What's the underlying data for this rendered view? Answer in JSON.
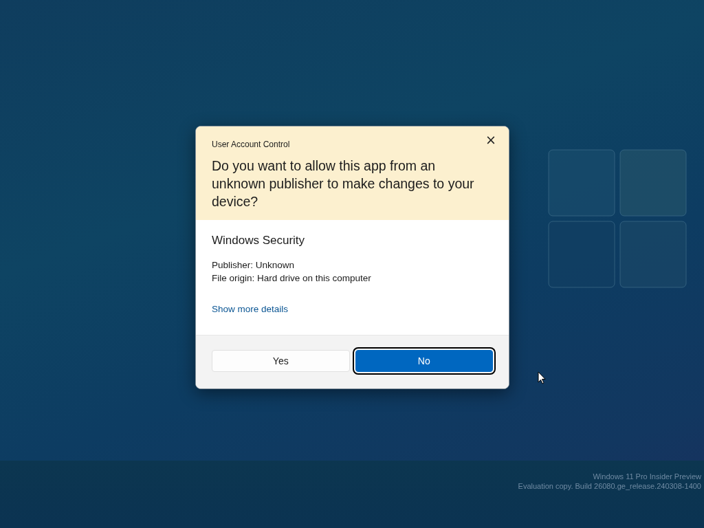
{
  "dialog": {
    "title": "User Account Control",
    "close_button": "×",
    "question": "Do you want to allow this app from an unknown publisher to make changes to your device?",
    "app_name": "Windows Security",
    "details": [
      "Publisher: Unknown",
      "File origin: Hard drive on this computer"
    ],
    "link": "Show more details",
    "buttons": [
      {
        "label": "Yes",
        "kind": "secondary",
        "selected": false
      },
      {
        "label": "No",
        "kind": "primary",
        "selected": true
      }
    ]
  },
  "desktop_notice": [
    "Windows 11 Pro Insider Preview",
    "Evaluation copy. Build 26080.ge_release.240308-1400"
  ]
}
